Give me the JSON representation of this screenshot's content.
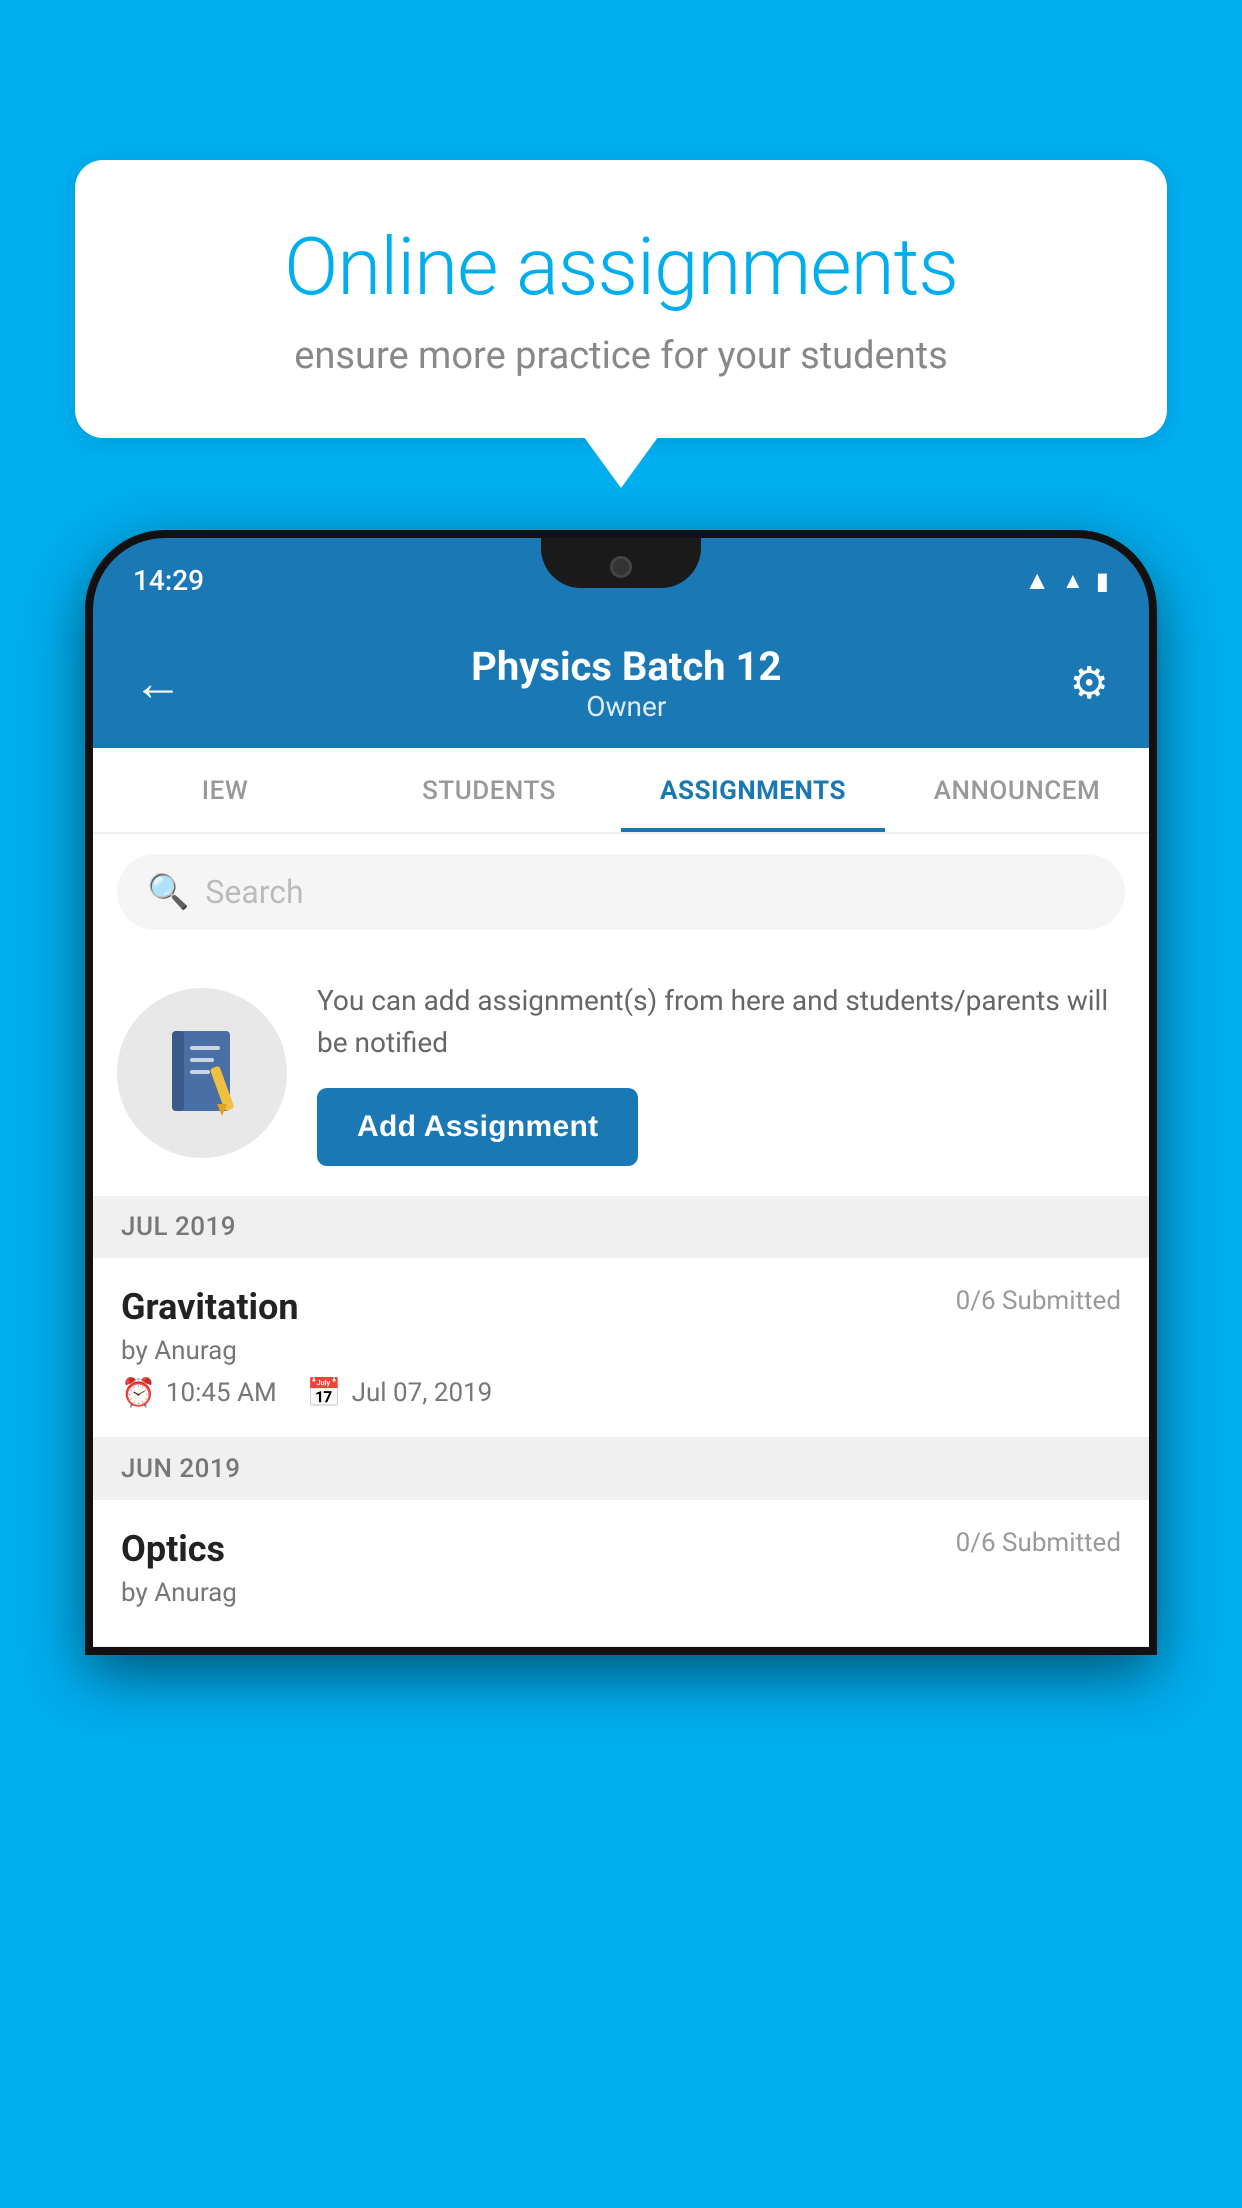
{
  "background_color": "#00AEEF",
  "bubble": {
    "title": "Online assignments",
    "subtitle": "ensure more practice for your students"
  },
  "phone": {
    "status_bar": {
      "time": "14:29"
    },
    "header": {
      "title": "Physics Batch 12",
      "subtitle": "Owner",
      "back_label": "←",
      "settings_label": "⚙"
    },
    "tabs": [
      {
        "label": "IEW",
        "active": false
      },
      {
        "label": "STUDENTS",
        "active": false
      },
      {
        "label": "ASSIGNMENTS",
        "active": true
      },
      {
        "label": "ANNOUNCEM",
        "active": false
      }
    ],
    "search": {
      "placeholder": "Search"
    },
    "promo": {
      "description": "You can add assignment(s) from here and students/parents will be notified",
      "button_label": "Add Assignment"
    },
    "assignment_groups": [
      {
        "month": "JUL 2019",
        "assignments": [
          {
            "name": "Gravitation",
            "submitted": "0/6 Submitted",
            "by": "by Anurag",
            "time": "10:45 AM",
            "date": "Jul 07, 2019"
          }
        ]
      },
      {
        "month": "JUN 2019",
        "assignments": [
          {
            "name": "Optics",
            "submitted": "0/6 Submitted",
            "by": "by Anurag",
            "time": "",
            "date": ""
          }
        ]
      }
    ]
  }
}
